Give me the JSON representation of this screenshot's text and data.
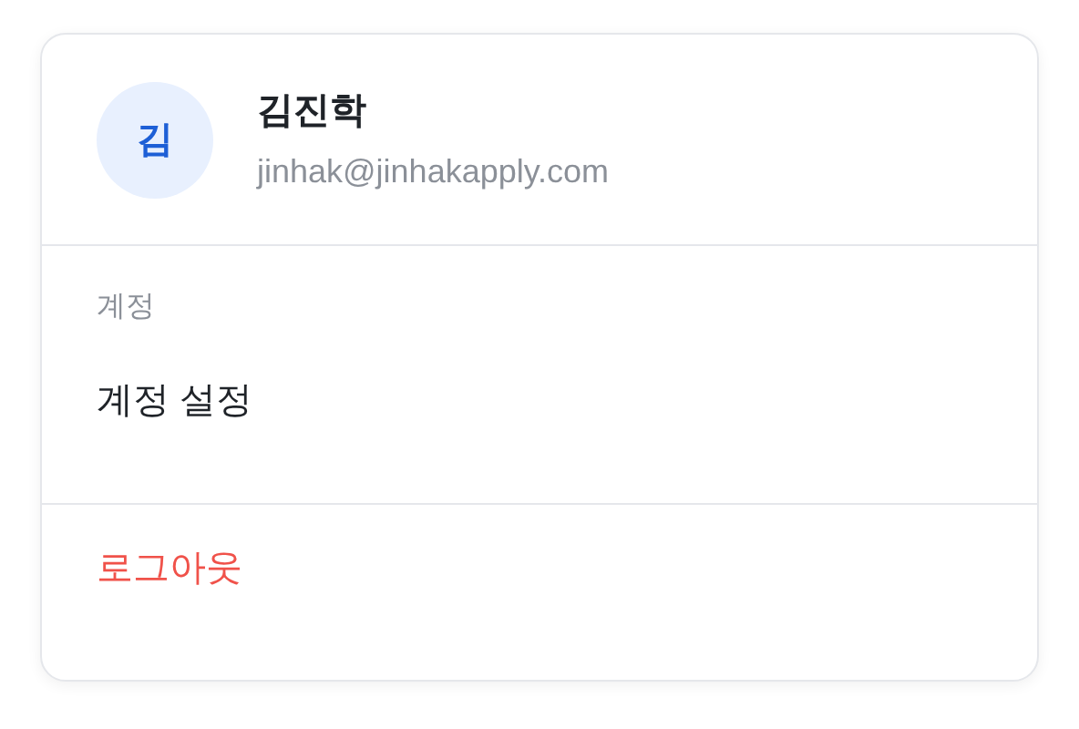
{
  "profile": {
    "avatar_initial": "김",
    "name": "김진학",
    "email": "jinhak@jinhakapply.com"
  },
  "sections": [
    {
      "heading": "계정",
      "items": [
        {
          "label": "계정 설정",
          "kind": "normal"
        }
      ]
    },
    {
      "items": [
        {
          "label": "로그아웃",
          "kind": "danger"
        }
      ]
    }
  ]
}
